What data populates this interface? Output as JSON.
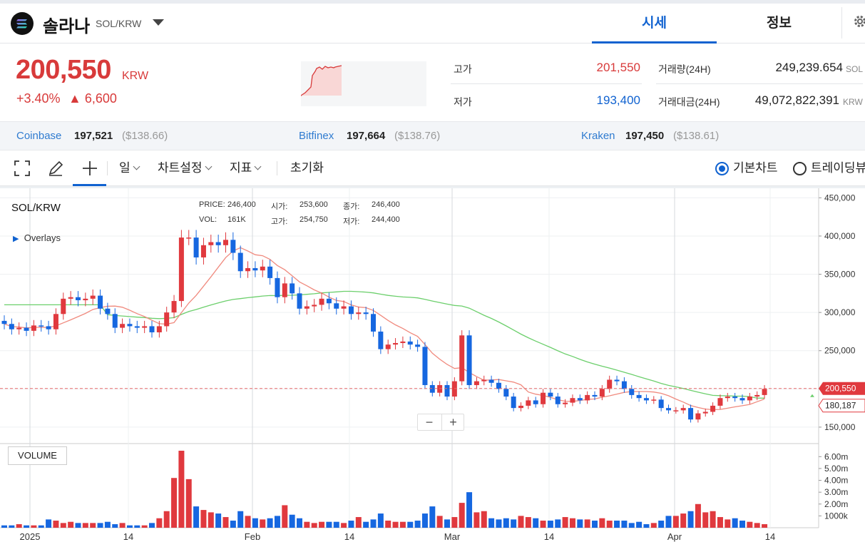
{
  "header": {
    "coin_name": "솔라나",
    "pair": "SOL/KRW",
    "tabs": [
      {
        "label": "시세",
        "active": true
      },
      {
        "label": "정보",
        "active": false
      }
    ]
  },
  "price": {
    "value": "200,550",
    "currency": "KRW",
    "change_pct": "+3.40%",
    "change_amt": "▲ 6,600"
  },
  "stats": {
    "high_label": "고가",
    "high": "201,550",
    "low_label": "저가",
    "low": "193,400",
    "vol_label": "거래량(24H)",
    "vol": "249,239.654",
    "vol_unit": "SOL",
    "amount_label": "거래대금(24H)",
    "amount": "49,072,822,391",
    "amount_unit": "KRW"
  },
  "exchanges": [
    {
      "name": "Coinbase",
      "price": "197,521",
      "usd": "($138.66)"
    },
    {
      "name": "Bitfinex",
      "price": "197,664",
      "usd": "($138.76)"
    },
    {
      "name": "Kraken",
      "price": "197,450",
      "usd": "($138.61)"
    }
  ],
  "toolbar": {
    "interval": "일",
    "chart_settings": "차트설정",
    "indicators": "지표",
    "reset": "초기화",
    "basic_chart": "기본차트",
    "trading_view": "트레이딩뷰"
  },
  "overlay": {
    "symbol": "SOL/KRW",
    "overlays_label": "Overlays",
    "price_label": "PRICE:",
    "price": "246,400",
    "open_label": "시가:",
    "open": "253,600",
    "close_label": "종가:",
    "close": "246,400",
    "vol_label": "VOL:",
    "vol": "161K",
    "high_label": "고가:",
    "high": "254,750",
    "low_label": "저가:",
    "low": "244,400",
    "volume_label": "VOLUME"
  },
  "zoom": {
    "minus": "−",
    "plus": "+"
  },
  "colors": {
    "up": "#e0393e",
    "down": "#1667e0",
    "ma_fast": "#f08a7e",
    "ma_slow": "#6ccf6c",
    "accent": "#1062d0"
  },
  "chart_data": {
    "type": "candlestick",
    "y_ticks": [
      "450,000",
      "400,000",
      "350,000",
      "300,000",
      "250,000",
      "200,000",
      "150,000"
    ],
    "vol_ticks": [
      "6.00m",
      "5.00m",
      "4.00m",
      "3.00m",
      "2.00m",
      "1000k"
    ],
    "x_ticks": [
      "2025",
      "14",
      "Feb",
      "14",
      "Mar",
      "14",
      "Apr",
      "14"
    ],
    "last_price_tag": "200,550",
    "ma_tag": "180,187",
    "ylim": [
      135000,
      455000
    ],
    "vol_max": 6.5,
    "closes": [
      285000,
      278000,
      280000,
      276000,
      283000,
      282000,
      278000,
      298000,
      318000,
      320000,
      316000,
      318000,
      322000,
      305000,
      298000,
      280000,
      285000,
      282000,
      280000,
      282000,
      274000,
      282000,
      300000,
      315000,
      398000,
      398000,
      372000,
      388000,
      392000,
      388000,
      395000,
      378000,
      354000,
      358000,
      355000,
      360000,
      345000,
      320000,
      338000,
      325000,
      305000,
      308000,
      310000,
      318000,
      312000,
      305000,
      308000,
      298000,
      300000,
      298000,
      275000,
      252000,
      258000,
      260000,
      262000,
      258000,
      255000,
      205000,
      195000,
      205000,
      190000,
      210000,
      270000,
      205000,
      210000,
      212000,
      208000,
      200000,
      190000,
      175000,
      178000,
      185000,
      180000,
      195000,
      190000,
      180000,
      182000,
      188000,
      185000,
      192000,
      190000,
      200000,
      212000,
      210000,
      200000,
      192000,
      188000,
      185000,
      186000,
      175000,
      172000,
      172000,
      175000,
      160000,
      168000,
      170000,
      178000,
      188000,
      190000,
      188000,
      185000,
      190000,
      192000,
      200000
    ],
    "volumes": [
      0.2,
      0.2,
      0.3,
      0.2,
      0.2,
      0.2,
      0.7,
      0.6,
      0.4,
      0.5,
      0.4,
      0.4,
      0.4,
      0.4,
      0.5,
      0.3,
      0.4,
      0.2,
      0.2,
      0.2,
      0.4,
      0.8,
      1.4,
      4.2,
      6.5,
      4.1,
      1.8,
      1.5,
      1.3,
      1.2,
      0.9,
      0.6,
      1.4,
      1.0,
      0.8,
      0.7,
      0.8,
      1.0,
      1.9,
      1.1,
      0.8,
      0.5,
      0.4,
      0.5,
      0.5,
      0.5,
      0.4,
      0.6,
      0.9,
      0.5,
      0.7,
      1.2,
      0.6,
      0.5,
      0.5,
      0.5,
      0.6,
      1.2,
      1.8,
      1.0,
      0.7,
      0.9,
      2.1,
      3.0,
      1.3,
      1.4,
      0.8,
      0.7,
      0.8,
      0.7,
      1.0,
      0.9,
      0.8,
      0.6,
      0.6,
      0.7,
      0.9,
      0.8,
      0.7,
      0.7,
      0.6,
      0.8,
      0.6,
      0.6,
      0.6,
      0.4,
      0.5,
      0.3,
      0.4,
      0.6,
      1.0,
      1.0,
      1.2,
      1.4,
      2.0,
      1.3,
      1.4,
      0.9,
      0.7,
      0.8,
      0.6,
      0.5,
      0.4,
      0.3
    ],
    "series": [
      {
        "name": "MA-fast"
      },
      {
        "name": "MA-slow"
      }
    ]
  }
}
